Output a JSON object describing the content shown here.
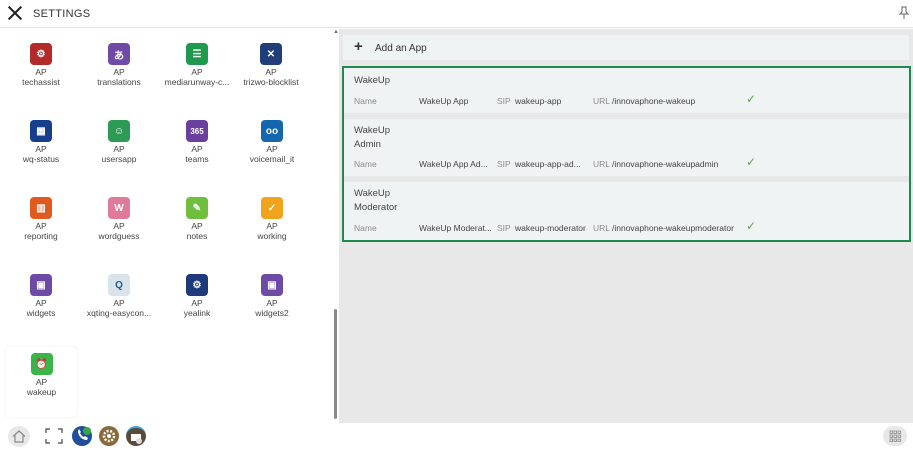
{
  "header": {
    "title": "SETTINGS"
  },
  "apps": [
    {
      "line1": "AP",
      "line2": "techassist",
      "color": "#b22a2a",
      "glyph": "⚙"
    },
    {
      "line1": "AP",
      "line2": "translations",
      "color": "#6f4aa6",
      "glyph": "あ"
    },
    {
      "line1": "AP",
      "line2": "mediarunway-c...",
      "color": "#1d9a4e",
      "glyph": "☰"
    },
    {
      "line1": "AP",
      "line2": "trizwo-blocklist",
      "color": "#1f3e7a",
      "glyph": "✕"
    },
    {
      "line1": "AP",
      "line2": "wq-status",
      "color": "#173e8c",
      "glyph": "▦"
    },
    {
      "line1": "AP",
      "line2": "usersapp",
      "color": "#2d9a55",
      "glyph": "☺"
    },
    {
      "line1": "AP",
      "line2": "teams",
      "color": "#6a3f9e",
      "glyph": "365"
    },
    {
      "line1": "AP",
      "line2": "voicemail_it",
      "color": "#1566b0",
      "glyph": "oo"
    },
    {
      "line1": "AP",
      "line2": "reporting",
      "color": "#e05a1f",
      "glyph": "▥"
    },
    {
      "line1": "AP",
      "line2": "wordguess",
      "color": "#e07a9a",
      "glyph": "W"
    },
    {
      "line1": "AP",
      "line2": "notes",
      "color": "#6fbf3c",
      "glyph": "✎"
    },
    {
      "line1": "AP",
      "line2": "working",
      "color": "#f0a31c",
      "glyph": "✓"
    },
    {
      "line1": "AP",
      "line2": "widgets",
      "color": "#6d4aa3",
      "glyph": "▣"
    },
    {
      "line1": "AP",
      "line2": "xqting-easycon...",
      "color": "#d8e4ea",
      "glyph": "Q"
    },
    {
      "line1": "AP",
      "line2": "yealink",
      "color": "#1e3a7a",
      "glyph": "⚙"
    },
    {
      "line1": "AP",
      "line2": "widgets2",
      "color": "#6d4aa3",
      "glyph": "▣"
    }
  ],
  "selected_app": {
    "line1": "AP",
    "line2": "wakeup",
    "color": "#39b54a",
    "glyph": "⏰"
  },
  "right": {
    "add_label": "Add an App",
    "labels": {
      "name": "Name",
      "sip": "SIP",
      "url": "URL"
    },
    "entries": [
      {
        "title_line1": "WakeUp",
        "title_line2": "",
        "name": "WakeUp App",
        "sip": "wakeup-app",
        "url": "/innovaphone-wakeup"
      },
      {
        "title_line1": "WakeUp",
        "title_line2": "Admin",
        "name": "WakeUp App Ad...",
        "sip": "wakeup-app-ad...",
        "url": "/innovaphone-wakeupadmin"
      },
      {
        "title_line1": "WakeUp",
        "title_line2": "Moderator",
        "name": "WakeUp Moderat...",
        "sip": "wakeup-moderator",
        "url": "/innovaphone-wakeupmoderator"
      }
    ]
  },
  "colors": {
    "highlight_border": "#1e8a4c",
    "check": "#5ba84c"
  }
}
